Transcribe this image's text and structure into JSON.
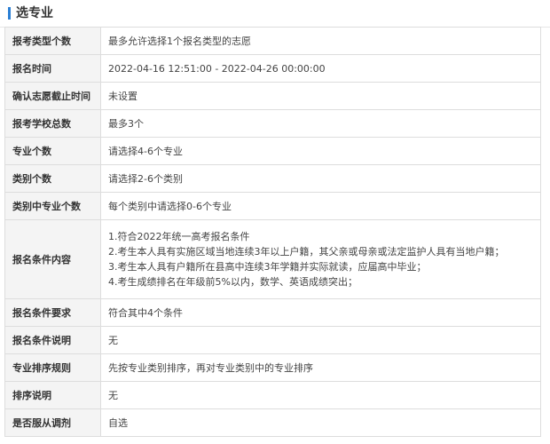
{
  "section_title": "选专业",
  "rows": [
    {
      "label": "报考类型个数",
      "value": "最多允许选择1个报名类型的志愿"
    },
    {
      "label": "报名时间",
      "value": "2022-04-16 12:51:00 - 2022-04-26 00:00:00"
    },
    {
      "label": "确认志愿截止时间",
      "value": "未设置"
    },
    {
      "label": "报考学校总数",
      "value": "最多3个"
    },
    {
      "label": "专业个数",
      "value": "请选择4-6个专业"
    },
    {
      "label": "类别个数",
      "value": "请选择2-6个类别"
    },
    {
      "label": "类别中专业个数",
      "value": "每个类别中请选择0-6个专业"
    },
    {
      "label": "报名条件内容",
      "lines": [
        "1.符合2022年统一高考报名条件",
        "2.考生本人具有实施区域当地连续3年以上户籍，其父亲或母亲或法定监护人具有当地户籍；",
        "3.考生本人具有户籍所在县高中连续3年学籍并实际就读，应届高中毕业；",
        "4.考生成绩排名在年级前5%以内，数学、英语成绩突出；"
      ]
    },
    {
      "label": "报名条件要求",
      "value": "符合其中4个条件"
    },
    {
      "label": "报名条件说明",
      "value": "无"
    },
    {
      "label": "专业排序规则",
      "value": "先按专业类别排序，再对专业类别中的专业排序"
    },
    {
      "label": "排序说明",
      "value": "无"
    },
    {
      "label": "是否服从调剂",
      "value": "自选"
    }
  ],
  "colors": {
    "accent": "#2a7fd4",
    "label_bg": "#f4f4f4",
    "border": "#dddddd"
  }
}
